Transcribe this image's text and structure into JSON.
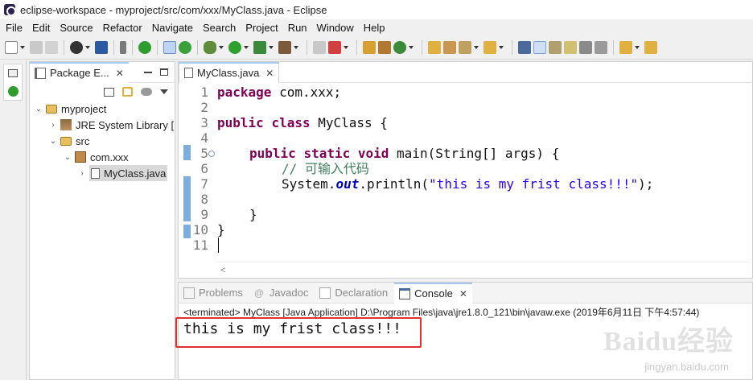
{
  "window": {
    "title": "eclipse-workspace - myproject/src/com/xxx/MyClass.java - Eclipse"
  },
  "menu": [
    "File",
    "Edit",
    "Source",
    "Refactor",
    "Navigate",
    "Search",
    "Project",
    "Run",
    "Window",
    "Help"
  ],
  "package_explorer": {
    "tab_label": "Package E...",
    "tree": [
      {
        "label": "myproject",
        "depth": 0,
        "expanded": true,
        "icon": "project-icon"
      },
      {
        "label": "JRE System Library [",
        "depth": 1,
        "expanded": false,
        "icon": "library-icon"
      },
      {
        "label": "src",
        "depth": 1,
        "expanded": true,
        "icon": "source-folder-icon"
      },
      {
        "label": "com.xxx",
        "depth": 2,
        "expanded": true,
        "icon": "package-icon"
      },
      {
        "label": "MyClass.java",
        "depth": 3,
        "expanded": false,
        "icon": "java-file-icon",
        "selected": true
      }
    ]
  },
  "editor": {
    "tab_label": "MyClass.java",
    "line_numbers": [
      "1",
      "2",
      "3",
      "4",
      "5",
      "6",
      "7",
      "8",
      "9",
      "10",
      "11"
    ],
    "lines": {
      "l1_kw": "package",
      "l1_rest": " com.xxx;",
      "l3_kw1": "public",
      "l3_kw2": "class",
      "l3_rest": " MyClass {",
      "l5_kw1": "public",
      "l5_kw2": "static",
      "l5_kw3": "void",
      "l5_rest": " main(String[] args) {",
      "l6_comment": "// 可输入代码",
      "l7_pre": "System.",
      "l7_field": "out",
      "l7_mid": ".println(",
      "l7_str": "\"this is my frist class!!!\"",
      "l7_end": ");",
      "l9": "}",
      "l10": "}"
    }
  },
  "console": {
    "tabs": [
      "Problems",
      "Javadoc",
      "Declaration",
      "Console"
    ],
    "active_tab": "Console",
    "status_line": "<terminated> MyClass [Java Application] D:\\Program Files\\java\\jre1.8.0_121\\bin\\javaw.exe (2019年6月11日 下午4:57:44)",
    "output": "this is my frist class!!!"
  },
  "watermark": {
    "brand": "Baidu经验",
    "url": "jingyan.baidu.com"
  },
  "colors": {
    "keyword": "#7f0055",
    "comment": "#3f7f5f",
    "string": "#2a00ff",
    "highlight_box": "#e03030"
  }
}
